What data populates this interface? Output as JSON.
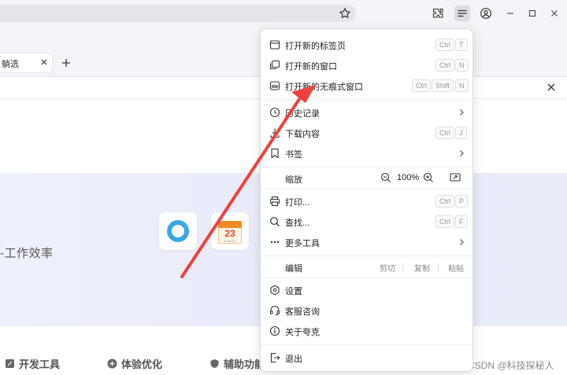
{
  "browser": {
    "tab": {
      "label": "躺选"
    },
    "colors": {
      "toolbar_bg": "#f3f4f7",
      "accent_red": "#ee4040",
      "menu_bg": "#ffffff"
    },
    "icons": [
      "star-icon",
      "extensions-icon",
      "menu-icon",
      "account-icon",
      "minimize-icon",
      "maximize-icon",
      "close-icon",
      "new-tab-icon"
    ]
  },
  "menu": {
    "items": [
      {
        "label": "打开新的标签页",
        "shortcut": [
          "Ctrl",
          "T"
        ]
      },
      {
        "label": "打开新的窗口",
        "shortcut": [
          "Ctrl",
          "N"
        ]
      },
      {
        "label": "打开新的无痕式窗口",
        "shortcut": [
          "Ctrl",
          "Shift",
          "N"
        ]
      },
      {
        "label": "历史记录"
      },
      {
        "label": "下载内容",
        "shortcut": [
          "Ctrl",
          "J"
        ]
      },
      {
        "label": "书签"
      },
      {
        "label": "缩放"
      },
      {
        "label": "打印...",
        "shortcut": [
          "Ctrl",
          "P"
        ]
      },
      {
        "label": "查找...",
        "shortcut": [
          "Ctrl",
          "F"
        ]
      },
      {
        "label": "更多工具"
      },
      {
        "label": "编辑"
      },
      {
        "label": "设置"
      },
      {
        "label": "客服咨询"
      },
      {
        "label": "关于夸克"
      },
      {
        "label": "退出"
      }
    ],
    "zoom": {
      "value": "100%"
    },
    "edit": {
      "cut": "剪切",
      "copy": "复制",
      "paste": "粘贴"
    }
  },
  "page": {
    "hero_text": "-工作效率",
    "calendar": {
      "num": "23",
      "sub": "SUNDAY"
    },
    "bottom_nav": [
      {
        "label": "开发工具"
      },
      {
        "label": "体验优化"
      },
      {
        "label": "辅助功能"
      }
    ]
  },
  "watermark": "CSDN @科技探秘人"
}
